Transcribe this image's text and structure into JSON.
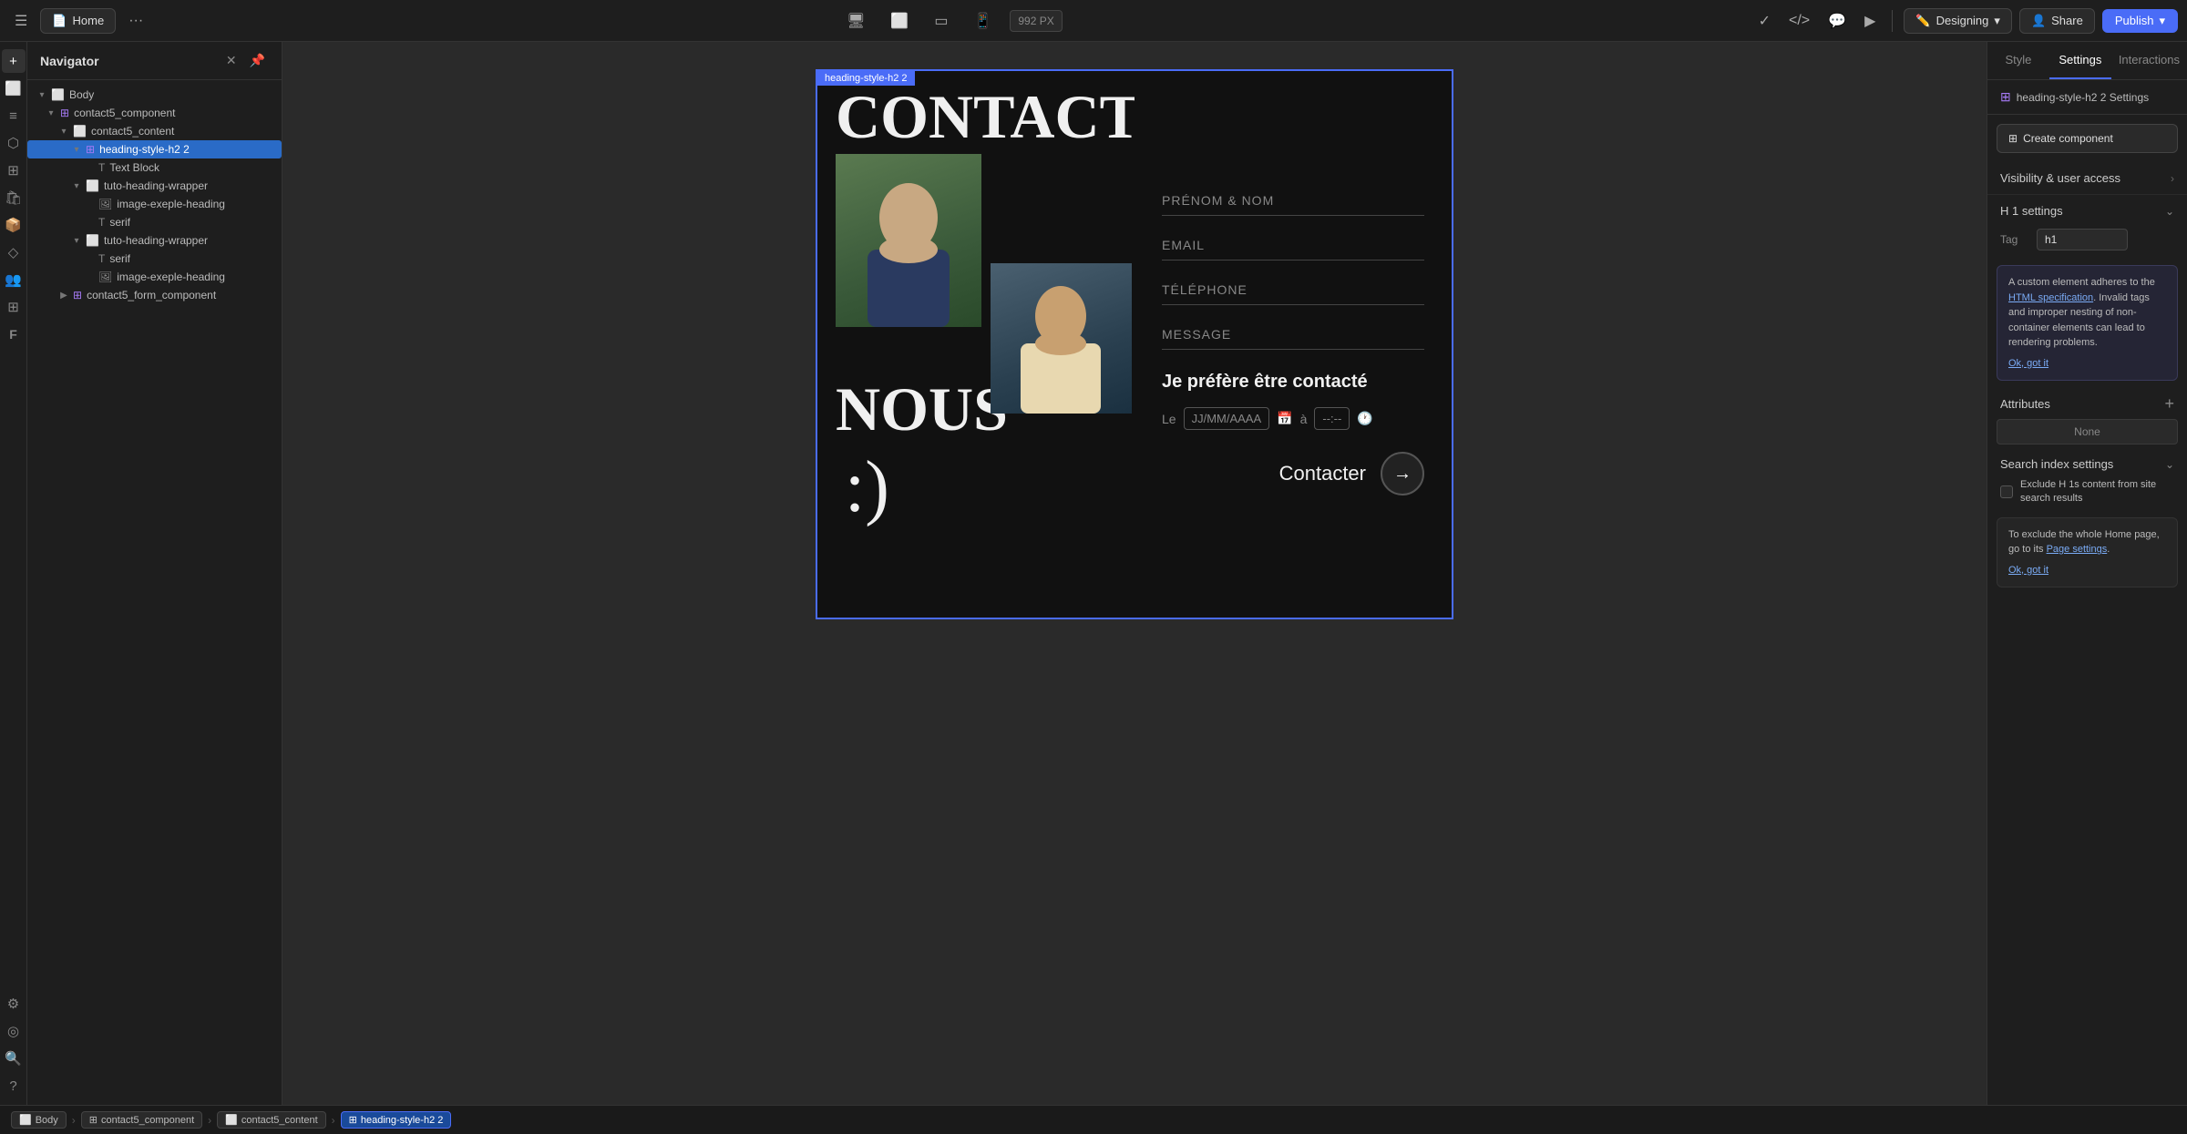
{
  "topbar": {
    "home_label": "Home",
    "px_label": "992 PX",
    "mode_label": "Designing",
    "share_label": "Share",
    "publish_label": "Publish"
  },
  "navigator": {
    "title": "Navigator",
    "items": [
      {
        "id": "body",
        "label": "Body",
        "indent": 0,
        "type": "box",
        "expanded": true
      },
      {
        "id": "contact5_component",
        "label": "contact5_component",
        "indent": 1,
        "type": "component",
        "expanded": true
      },
      {
        "id": "contact5_content",
        "label": "contact5_content",
        "indent": 2,
        "type": "box",
        "expanded": true
      },
      {
        "id": "heading-style-h2-2",
        "label": "heading-style-h2 2",
        "indent": 3,
        "type": "component",
        "expanded": true,
        "selected": true
      },
      {
        "id": "text-block",
        "label": "Text Block",
        "indent": 4,
        "type": "text"
      },
      {
        "id": "tuto-heading-wrapper-1",
        "label": "tuto-heading-wrapper",
        "indent": 3,
        "type": "box",
        "expanded": true
      },
      {
        "id": "image-exeple-heading-1",
        "label": "image-exeple-heading",
        "indent": 4,
        "type": "image"
      },
      {
        "id": "serif-1",
        "label": "serif",
        "indent": 4,
        "type": "text"
      },
      {
        "id": "tuto-heading-wrapper-2",
        "label": "tuto-heading-wrapper",
        "indent": 3,
        "type": "box",
        "expanded": true
      },
      {
        "id": "serif-2",
        "label": "serif",
        "indent": 4,
        "type": "text"
      },
      {
        "id": "image-exeple-heading-2",
        "label": "image-exeple-heading",
        "indent": 4,
        "type": "image"
      },
      {
        "id": "contact5_form_component",
        "label": "contact5_form_component",
        "indent": 2,
        "type": "component",
        "expanded": false
      }
    ]
  },
  "canvas": {
    "heading_badge": "heading-style-h2 2",
    "contactez_text": "CONTACTEZ",
    "nous_text": "NOUS",
    "smiley": ":)",
    "form_fields": [
      "PRÉNOM & NOM",
      "EMAIL",
      "TÉLÉPHONE",
      "MESSAGE"
    ],
    "contact_prefer": "Je préfère être contacté",
    "date_label": "Le",
    "date_placeholder": "JJ/MM/AAAA",
    "time_separator": "à",
    "time_placeholder": "--:--",
    "contacter_label": "Contacter"
  },
  "right_panel": {
    "tabs": [
      "Style",
      "Settings",
      "Interactions"
    ],
    "active_tab": "Settings",
    "settings_header": "heading-style-h2 2 Settings",
    "create_component_label": "Create component",
    "visibility_label": "Visibility & user access",
    "h1_settings_label": "H 1 settings",
    "tag_label": "Tag",
    "tag_value": "h1",
    "info_text_1": "A custom element adheres to the ",
    "info_link": "HTML specification",
    "info_text_2": ". Invalid tags and improper nesting of non-container elements can lead to rendering problems.",
    "ok_got_it_1": "Ok, got it",
    "attributes_label": "Attributes",
    "none_label": "None",
    "search_index_label": "Search index settings",
    "exclude_label": "Exclude H 1s content from site search results",
    "tooltip_text_1": "To exclude the whole Home page, go to its ",
    "tooltip_link": "Page settings",
    "tooltip_text_2": ".",
    "ok_got_it_2": "Ok, got it"
  },
  "bottom_bar": {
    "breadcrumbs": [
      "Body",
      "contact5_component",
      "contact5_content",
      "heading-style-h2 2"
    ]
  }
}
